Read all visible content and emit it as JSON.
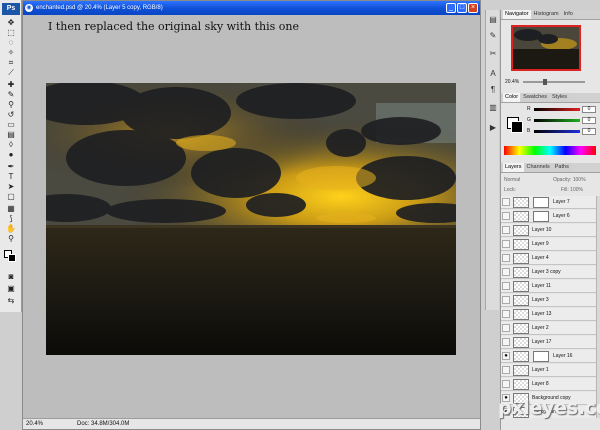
{
  "app": {
    "logo": "Ps"
  },
  "document": {
    "title": "enchanted.psd @ 20.4% (Layer 5 copy, RGB/8)",
    "caption": "I then replaced the original sky with this one",
    "status_zoom": "20.4%",
    "status_doc": "Doc: 34.8M/304.0M"
  },
  "window_buttons": [
    "_",
    "□",
    "×"
  ],
  "navigator": {
    "tabs": [
      "Navigator",
      "Histogram",
      "Info"
    ],
    "zoom": "20.4%"
  },
  "color_panel": {
    "tabs": [
      "Color",
      "Swatches",
      "Styles"
    ],
    "channels": [
      {
        "label": "R",
        "value": "0",
        "color": "#e02020"
      },
      {
        "label": "G",
        "value": "0",
        "color": "#20b020"
      },
      {
        "label": "B",
        "value": "0",
        "color": "#2030e0"
      }
    ]
  },
  "layers_panel": {
    "tabs": [
      "Layers",
      "Channels",
      "Paths"
    ],
    "blend_mode": "Normal",
    "opacity": "Opacity: 100%",
    "lock": "Lock:",
    "fill": "Fill: 100%",
    "layers": [
      {
        "name": "Layer 7",
        "mask": true
      },
      {
        "name": "Layer 6",
        "mask": true
      },
      {
        "name": "Layer 10",
        "mask": false
      },
      {
        "name": "Layer 9",
        "mask": false
      },
      {
        "name": "Layer 4",
        "mask": false
      },
      {
        "name": "Layer 3 copy",
        "mask": false
      },
      {
        "name": "Layer 11",
        "mask": false
      },
      {
        "name": "Layer 3",
        "mask": false
      },
      {
        "name": "Layer 13",
        "mask": false
      },
      {
        "name": "Layer 2",
        "mask": false
      },
      {
        "name": "Layer 17",
        "mask": false
      },
      {
        "name": "Layer 16",
        "mask": true,
        "visible": true
      },
      {
        "name": "Layer 1",
        "mask": false
      },
      {
        "name": "Layer 8",
        "mask": false
      },
      {
        "name": "Background copy",
        "mask": false,
        "visible": true
      },
      {
        "name": "Background",
        "mask": false,
        "visible": true
      }
    ]
  },
  "watermark": "pxleyes.com"
}
